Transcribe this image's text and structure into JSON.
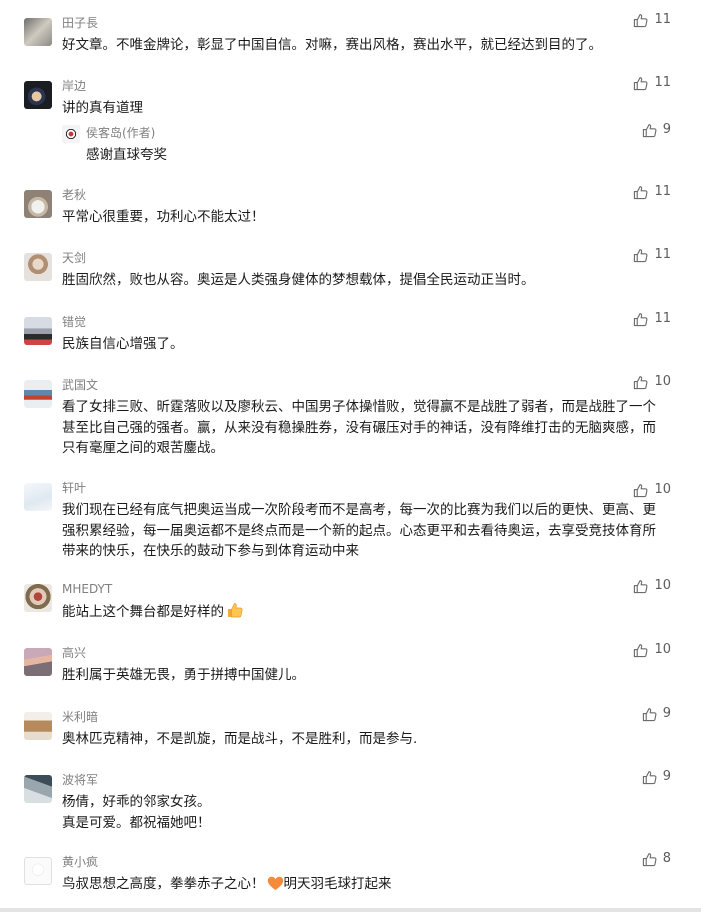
{
  "comments": [
    {
      "nick": "田子長",
      "likes": "11",
      "text": "好文章。不唯金牌论，彰显了中国自信。对嘛，赛出风格，赛出水平，就已经达到目的了。"
    },
    {
      "nick": "岸边",
      "likes": "11",
      "text": "讲的真有道理",
      "reply": {
        "nick": "侯客岛(作者)",
        "likes": "9",
        "text": "感谢直球夸奖"
      }
    },
    {
      "nick": "老秋",
      "likes": "11",
      "text": "平常心很重要，功利心不能太过！"
    },
    {
      "nick": "天剑",
      "likes": "11",
      "text": "胜固欣然，败也从容。奥运是人类强身健体的梦想载体，提倡全民运动正当时。"
    },
    {
      "nick": "错觉",
      "likes": "11",
      "text": "民族自信心增强了。"
    },
    {
      "nick": "武国文",
      "likes": "10",
      "text": "看了女排三败、昕霆落败以及廖秋云、中国男子体操惜败，觉得赢不是战胜了弱者，而是战胜了一个甚至比自己强的强者。赢，从来没有稳操胜券，没有碾压对手的神话，没有降维打击的无脑爽感，而只有毫厘之间的艰苦鏖战。"
    },
    {
      "nick": "轩叶",
      "likes": "10",
      "text": "我们现在已经有底气把奥运当成一次阶段考而不是高考，每一次的比赛为我们以后的更快、更高、更强积累经验，每一届奥运都不是终点而是一个新的起点。心态更平和去看待奥运，去享受竞技体育所带来的快乐，在快乐的鼓动下参与到体育运动中来"
    },
    {
      "nick": "MHEDYT",
      "likes": "10",
      "text": "能站上这个舞台都是好样的",
      "emoji": "thumbs-up-emoji"
    },
    {
      "nick": "高兴",
      "likes": "10",
      "text": "胜利属于英雄无畏，勇于拼搏中国健儿。"
    },
    {
      "nick": "米利暗",
      "likes": "9",
      "text": "奥林匹克精神，不是凯旋，而是战斗，不是胜利，而是参与."
    },
    {
      "nick": "波将军",
      "likes": "9",
      "text": "杨倩，好乖的邻家女孩。",
      "text2": "真是可爱。都祝福她吧！"
    },
    {
      "nick": "黄小疯",
      "likes": "8",
      "text": "鸟叔思想之高度，拳拳赤子之心！",
      "emoji": "orange-heart-emoji",
      "text_after": "明天羽毛球打起来"
    }
  ],
  "icons": {
    "like": "thumbs-up-outline-icon"
  },
  "colors": {
    "background": "#ededed",
    "card": "#ffffff",
    "nick": "#7f7f7f",
    "text": "#1a1a1a",
    "like": "#5c5c5c"
  }
}
